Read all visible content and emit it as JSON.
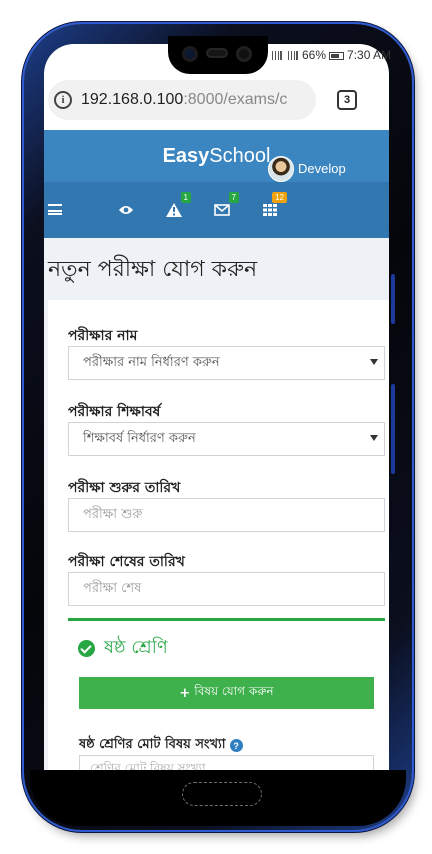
{
  "status": {
    "network": "66%",
    "time": "7:30 AM"
  },
  "browser": {
    "url_host": "192.168.0.100",
    "url_path": ":8000/exams/c",
    "tab_count": "3"
  },
  "app": {
    "brand_bold": "Easy",
    "brand_regular": "School"
  },
  "nav": {
    "badges": {
      "alerts": "1",
      "messages": "7",
      "apps": "12"
    },
    "user_name": "Develop"
  },
  "page": {
    "title": "নতুন পরীক্ষা যোগ করুন"
  },
  "form": {
    "exam_name_label": "পরীক্ষার নাম",
    "exam_name_value": "পরীক্ষার নাম নির্ধারণ করুন",
    "academic_year_label": "পরীক্ষার শিক্ষাবর্ষ",
    "academic_year_value": "শিক্ষাবর্ষ নির্ধারণ করুন",
    "start_date_label": "পরীক্ষা শুরুর তারিখ",
    "start_date_placeholder": "পরীক্ষা শুরু",
    "end_date_label": "পরীক্ষা শেষের তারিখ",
    "end_date_placeholder": "পরীক্ষা শেষ"
  },
  "class_panel": {
    "title": "ষষ্ঠ শ্রেণি",
    "add_subject_label": "বিষয় যোগ করুন",
    "total_subjects_label": "ষষ্ঠ শ্রেণির মোট বিষয় সংখ্যা",
    "total_subjects_placeholder": "শ্রেণির মোট বিষয় সংখ্যা"
  },
  "colors": {
    "header": "#3b85c0",
    "navbar": "#3277af",
    "success": "#27a744",
    "button": "#3fb14c"
  }
}
